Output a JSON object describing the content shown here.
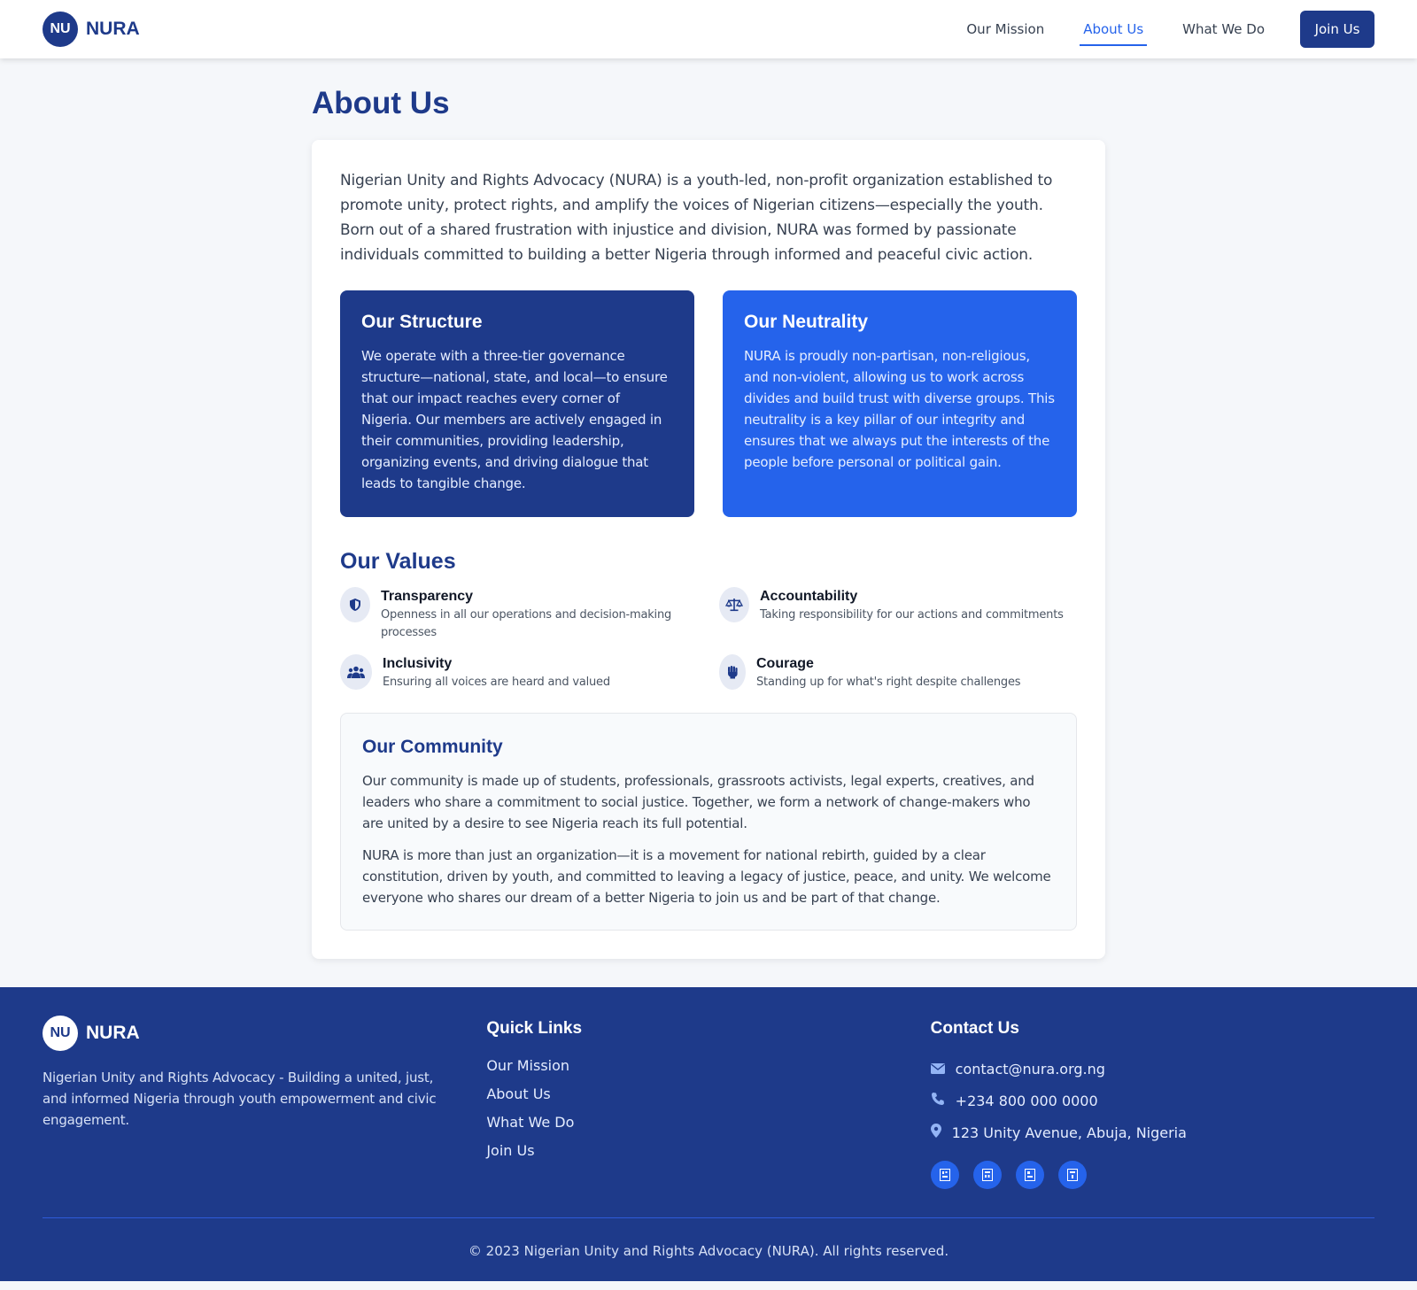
{
  "brand": {
    "logo_text": "NU",
    "name": "NURA"
  },
  "nav": {
    "links": [
      {
        "label": "Our Mission",
        "active": false
      },
      {
        "label": "About Us",
        "active": true
      },
      {
        "label": "What We Do",
        "active": false
      }
    ],
    "join_label": "Join Us"
  },
  "page": {
    "title": "About Us",
    "intro": "Nigerian Unity and Rights Advocacy (NURA) is a youth-led, non-profit organization established to promote unity, protect rights, and amplify the voices of Nigerian citizens—especially the youth. Born out of a shared frustration with injustice and division, NURA was formed by passionate individuals committed to building a better Nigeria through informed and peaceful civic action."
  },
  "structure": {
    "title": "Our Structure",
    "text": "We operate with a three-tier governance structure—national, state, and local—to ensure that our impact reaches every corner of Nigeria. Our members are actively engaged in their communities, providing leadership, organizing events, and driving dialogue that leads to tangible change."
  },
  "neutrality": {
    "title": "Our Neutrality",
    "text": "NURA is proudly non-partisan, non-religious, and non-violent, allowing us to work across divides and build trust with diverse groups. This neutrality is a key pillar of our integrity and ensures that we always put the interests of the people before personal or political gain."
  },
  "values": {
    "title": "Our Values",
    "items": [
      {
        "name": "Transparency",
        "desc": "Openness in all our operations and decision-making processes",
        "icon": "shield-icon"
      },
      {
        "name": "Accountability",
        "desc": "Taking responsibility for our actions and commitments",
        "icon": "scale-icon"
      },
      {
        "name": "Inclusivity",
        "desc": "Ensuring all voices are heard and valued",
        "icon": "users-icon"
      },
      {
        "name": "Courage",
        "desc": "Standing up for what's right despite challenges",
        "icon": "fist-icon"
      }
    ]
  },
  "community": {
    "title": "Our Community",
    "p1": "Our community is made up of students, professionals, grassroots activists, legal experts, creatives, and leaders who share a commitment to social justice. Together, we form a network of change-makers who are united by a desire to see Nigeria reach its full potential.",
    "p2": "NURA is more than just an organization—it is a movement for national rebirth, guided by a clear constitution, driven by youth, and committed to leaving a legacy of justice, peace, and unity. We welcome everyone who shares our dream of a better Nigeria to join us and be part of that change."
  },
  "footer": {
    "logo_text": "NU",
    "name": "NURA",
    "desc": "Nigerian Unity and Rights Advocacy - Building a united, just, and informed Nigeria through youth empowerment and civic engagement.",
    "quick_links_title": "Quick Links",
    "quick_links": [
      "Our Mission",
      "About Us",
      "What We Do",
      "Join Us"
    ],
    "contact_title": "Contact Us",
    "email": "contact@nura.org.ng",
    "phone": "+234 800 000 0000",
    "address": "123 Unity Avenue, Abuja, Nigeria",
    "socials": [
      "social-icon-1",
      "social-icon-2",
      "social-icon-3",
      "social-icon-4"
    ],
    "copyright": "© 2023 Nigerian Unity and Rights Advocacy (NURA). All rights reserved."
  },
  "colors": {
    "primary": "#1e3a8a",
    "accent": "#2563eb",
    "background": "#f5f7fa"
  }
}
